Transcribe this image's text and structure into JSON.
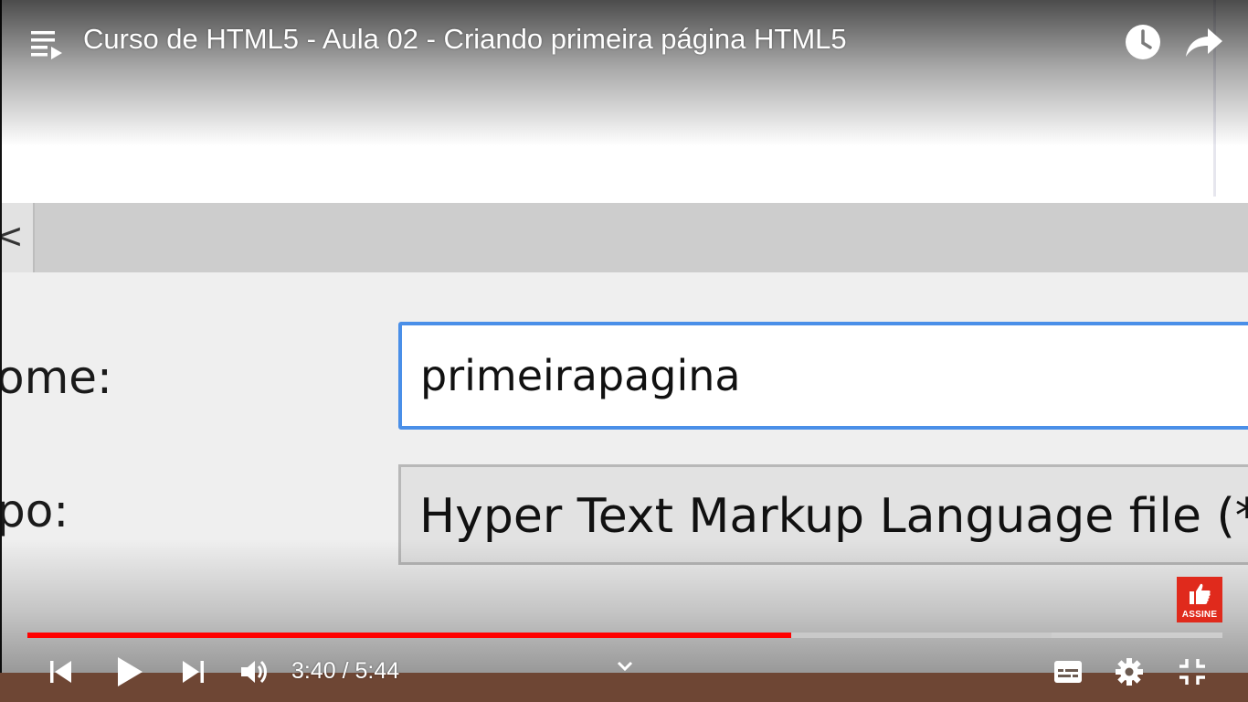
{
  "player": {
    "title": "Curso de HTML5 - Aula 02 - Criando primeira página HTML5",
    "time": {
      "current": "3:40",
      "separator": " / ",
      "total": "5:44"
    },
    "progress": {
      "played_fraction": 0.639,
      "buffered_fraction": 0.857,
      "played_color": "#ff0000"
    },
    "subscribe_badge": {
      "label": "ASSINE",
      "color": "#e02a1c"
    },
    "icons": {
      "playlist": "playlist-icon",
      "watch_later": "clock-icon",
      "share": "share-arrow-icon",
      "previous": "skip-previous-icon",
      "play": "play-icon",
      "next": "skip-next-icon",
      "volume": "volume-icon",
      "expand": "chevron-down-icon",
      "captions": "subtitles-icon",
      "settings": "gear-icon",
      "exit_fullscreen": "exit-fullscreen-icon"
    }
  },
  "video_content": {
    "name_label": "ome:",
    "name_value": "primeirapagina",
    "type_label": "po:",
    "type_value": "Hyper Text Markup Language file (*.ht",
    "toolbar_glyph": "<"
  }
}
